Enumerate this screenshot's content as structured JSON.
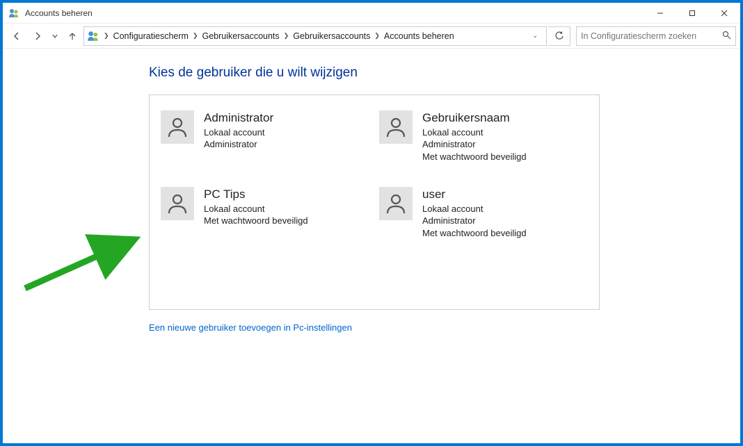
{
  "window": {
    "title": "Accounts beheren"
  },
  "breadcrumb": {
    "root": "Configuratiescherm",
    "l1": "Gebruikersaccounts",
    "l2": "Gebruikersaccounts",
    "l3": "Accounts beheren"
  },
  "search": {
    "placeholder": "In Configuratiescherm zoeken"
  },
  "main": {
    "heading": "Kies de gebruiker die u wilt wijzigen",
    "add_user_link": "Een nieuwe gebruiker toevoegen in Pc-instellingen"
  },
  "accounts": [
    {
      "name": "Administrator",
      "line1": "Lokaal account",
      "line2": "Administrator",
      "line3": ""
    },
    {
      "name": "Gebruikersnaam",
      "line1": "Lokaal account",
      "line2": "Administrator",
      "line3": "Met wachtwoord beveiligd"
    },
    {
      "name": "PC Tips",
      "line1": "Lokaal account",
      "line2": "Met wachtwoord beveiligd",
      "line3": ""
    },
    {
      "name": "user",
      "line1": "Lokaal account",
      "line2": "Administrator",
      "line3": "Met wachtwoord beveiligd"
    }
  ]
}
